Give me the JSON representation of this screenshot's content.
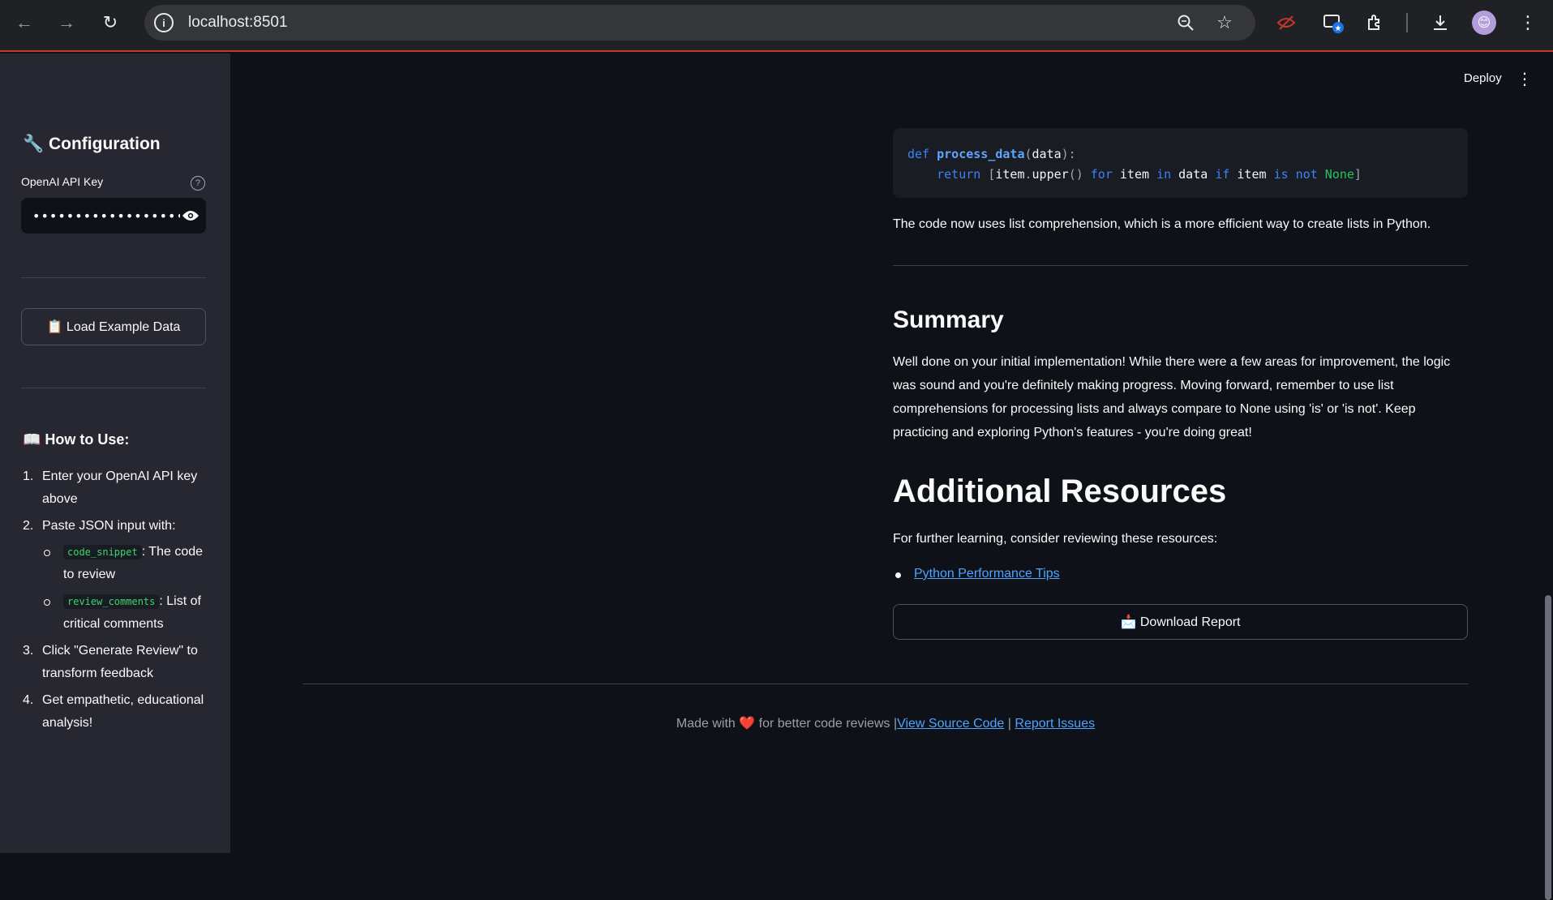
{
  "browser": {
    "url": "localhost:8501"
  },
  "sidebar": {
    "title": "🔧 Configuration",
    "api_key_label": "OpenAI API Key",
    "api_key_value": "••••••••••••••••••••••••••••",
    "load_button": "📋 Load Example Data",
    "how_to_title": "📖 How to Use:",
    "steps": [
      {
        "num": "1.",
        "text": "Enter your OpenAI API key above"
      },
      {
        "num": "2.",
        "text": "Paste JSON input with:"
      },
      {
        "num": "3.",
        "text": "Click \"Generate Review\" to transform feedback"
      },
      {
        "num": "4.",
        "text": "Get empathetic, educational analysis!"
      }
    ],
    "sub_steps": [
      {
        "code": "code_snippet",
        "text": ": The code to review"
      },
      {
        "code": "review_comments",
        "text": ": List of critical comments"
      }
    ]
  },
  "header": {
    "deploy": "Deploy"
  },
  "main": {
    "code_line1": {
      "kw": "def",
      "fn": "process_data",
      "p1": "(",
      "arg": "data",
      "p2": "):"
    },
    "code_line2": {
      "ret": "return",
      "b1": "[",
      "item": "item",
      "dot": ".",
      "upper": "upper",
      "call": "()",
      "for": "for",
      "item2": "item",
      "in": "in",
      "data": "data",
      "if": "if",
      "item3": "item",
      "is": "is",
      "not": "not",
      "none": "None",
      "b2": "]"
    },
    "code_note": "The code now uses list comprehension, which is a more efficient way to create lists in Python.",
    "summary_title": "Summary",
    "summary_text": "Well done on your initial implementation! While there were a few areas for improvement, the logic was sound and you're definitely making progress. Moving forward, remember to use list comprehensions for processing lists and always compare to None using 'is' or 'is not'. Keep practicing and exploring Python's features - you're doing great!",
    "resources_title": "Additional Resources",
    "resources_intro": "For further learning, consider reviewing these resources:",
    "resource_link": "Python Performance Tips",
    "download_button": "📩 Download Report"
  },
  "footer": {
    "made_with": "Made with",
    "heart": "❤️",
    "tail": "for better code reviews |",
    "source_link": "View Source Code",
    "sep": "|",
    "issues_link": "Report Issues"
  }
}
